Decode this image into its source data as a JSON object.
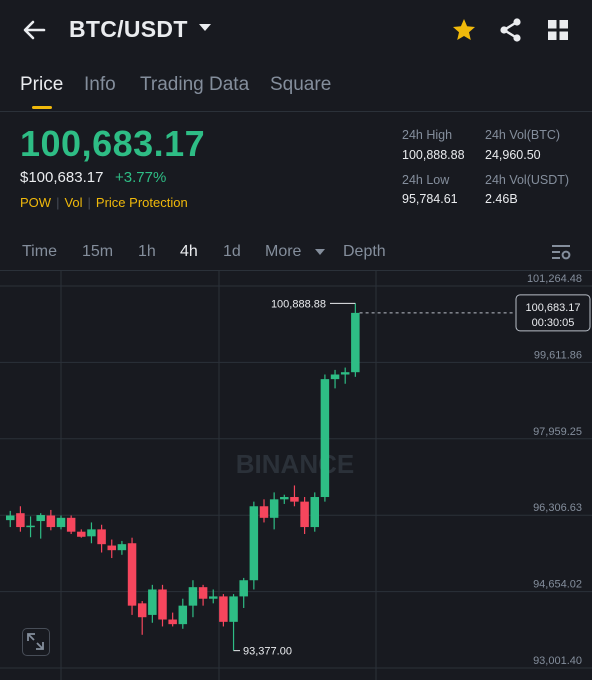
{
  "header": {
    "pair": "BTC/USDT",
    "icons": [
      "back-arrow-icon",
      "dropdown-caret-icon",
      "star-icon",
      "share-icon",
      "grid-icon"
    ],
    "favorite_color": "#f0b90b"
  },
  "tabs": [
    {
      "label": "Price",
      "active": true
    },
    {
      "label": "Info",
      "active": false
    },
    {
      "label": "Trading Data",
      "active": false
    },
    {
      "label": "Square",
      "active": false
    }
  ],
  "summary": {
    "last_price": "100,683.17",
    "usd_price": "$100,683.17",
    "change": "+3.77%",
    "tags": [
      "POW",
      "Vol",
      "Price Protection"
    ],
    "stats": {
      "high_label": "24h High",
      "high_value": "100,888.88",
      "vol_btc_label": "24h Vol(BTC)",
      "vol_btc_value": "24,960.50",
      "low_label": "24h Low",
      "low_value": "95,784.61",
      "vol_usdt_label": "24h Vol(USDT)",
      "vol_usdt_value": "2.46B"
    }
  },
  "timeframes": [
    {
      "label": "Time",
      "active": false
    },
    {
      "label": "15m",
      "active": false
    },
    {
      "label": "1h",
      "active": false
    },
    {
      "label": "4h",
      "active": true
    },
    {
      "label": "1d",
      "active": false
    },
    {
      "label": "More",
      "active": false
    },
    {
      "label": "Depth",
      "active": false
    }
  ],
  "colors": {
    "up": "#2ebd85",
    "down": "#f6465d",
    "accent": "#f0b90b",
    "background": "#181a20"
  },
  "chart_data": {
    "type": "candlestick",
    "interval": "4h",
    "watermark": "BINANCE",
    "y_ticks": [
      101264.48,
      99611.86,
      97959.25,
      96306.63,
      94654.02,
      93001.4
    ],
    "y_tick_labels": [
      "101,264.48",
      "99,611.86",
      "97,959.25",
      "96,306.63",
      "94,654.02",
      "93,001.40"
    ],
    "ylim": [
      93001.4,
      101264.48
    ],
    "last_price_label": "100,683.17",
    "countdown": "00:30:05",
    "high_marker": {
      "label": "100,888.88",
      "value": 100888.88
    },
    "low_marker": {
      "label": "93,377.00",
      "value": 93377.0
    },
    "candles": [
      {
        "o": 96200,
        "h": 96400,
        "l": 96050,
        "c": 96300
      },
      {
        "o": 96350,
        "h": 96500,
        "l": 95950,
        "c": 96050
      },
      {
        "o": 96050,
        "h": 96280,
        "l": 95830,
        "c": 96080
      },
      {
        "o": 96180,
        "h": 96350,
        "l": 95800,
        "c": 96310
      },
      {
        "o": 96300,
        "h": 96420,
        "l": 95980,
        "c": 96050
      },
      {
        "o": 96050,
        "h": 96300,
        "l": 96000,
        "c": 96250
      },
      {
        "o": 96250,
        "h": 96300,
        "l": 95900,
        "c": 95950
      },
      {
        "o": 95950,
        "h": 96000,
        "l": 95820,
        "c": 95840
      },
      {
        "o": 95850,
        "h": 96150,
        "l": 95700,
        "c": 96000
      },
      {
        "o": 96000,
        "h": 96100,
        "l": 95500,
        "c": 95680
      },
      {
        "o": 95650,
        "h": 95780,
        "l": 95380,
        "c": 95550
      },
      {
        "o": 95550,
        "h": 95750,
        "l": 95450,
        "c": 95680
      },
      {
        "o": 95700,
        "h": 95820,
        "l": 94150,
        "c": 94350
      },
      {
        "o": 94400,
        "h": 94450,
        "l": 93720,
        "c": 94100
      },
      {
        "o": 94150,
        "h": 94800,
        "l": 93980,
        "c": 94700
      },
      {
        "o": 94700,
        "h": 94800,
        "l": 93900,
        "c": 94050
      },
      {
        "o": 94050,
        "h": 94200,
        "l": 93900,
        "c": 93950
      },
      {
        "o": 93950,
        "h": 94500,
        "l": 93850,
        "c": 94350
      },
      {
        "o": 94350,
        "h": 94900,
        "l": 94100,
        "c": 94750
      },
      {
        "o": 94750,
        "h": 94800,
        "l": 94350,
        "c": 94500
      },
      {
        "o": 94500,
        "h": 94700,
        "l": 94400,
        "c": 94550
      },
      {
        "o": 94550,
        "h": 94600,
        "l": 93900,
        "c": 94000
      },
      {
        "o": 94000,
        "h": 94600,
        "l": 93377,
        "c": 94550
      },
      {
        "o": 94550,
        "h": 94950,
        "l": 94300,
        "c": 94900
      },
      {
        "o": 94900,
        "h": 96600,
        "l": 94700,
        "c": 96500
      },
      {
        "o": 96500,
        "h": 96650,
        "l": 96150,
        "c": 96250
      },
      {
        "o": 96250,
        "h": 96800,
        "l": 96000,
        "c": 96650
      },
      {
        "o": 96650,
        "h": 96750,
        "l": 96550,
        "c": 96700
      },
      {
        "o": 96700,
        "h": 96950,
        "l": 96500,
        "c": 96600
      },
      {
        "o": 96600,
        "h": 96700,
        "l": 95900,
        "c": 96050
      },
      {
        "o": 96050,
        "h": 96800,
        "l": 95950,
        "c": 96700
      },
      {
        "o": 96700,
        "h": 99350,
        "l": 96600,
        "c": 99250
      },
      {
        "o": 99250,
        "h": 99450,
        "l": 99050,
        "c": 99350
      },
      {
        "o": 99350,
        "h": 99500,
        "l": 99150,
        "c": 99400
      },
      {
        "o": 99400,
        "h": 100888.88,
        "l": 99300,
        "c": 100683.17
      }
    ]
  }
}
